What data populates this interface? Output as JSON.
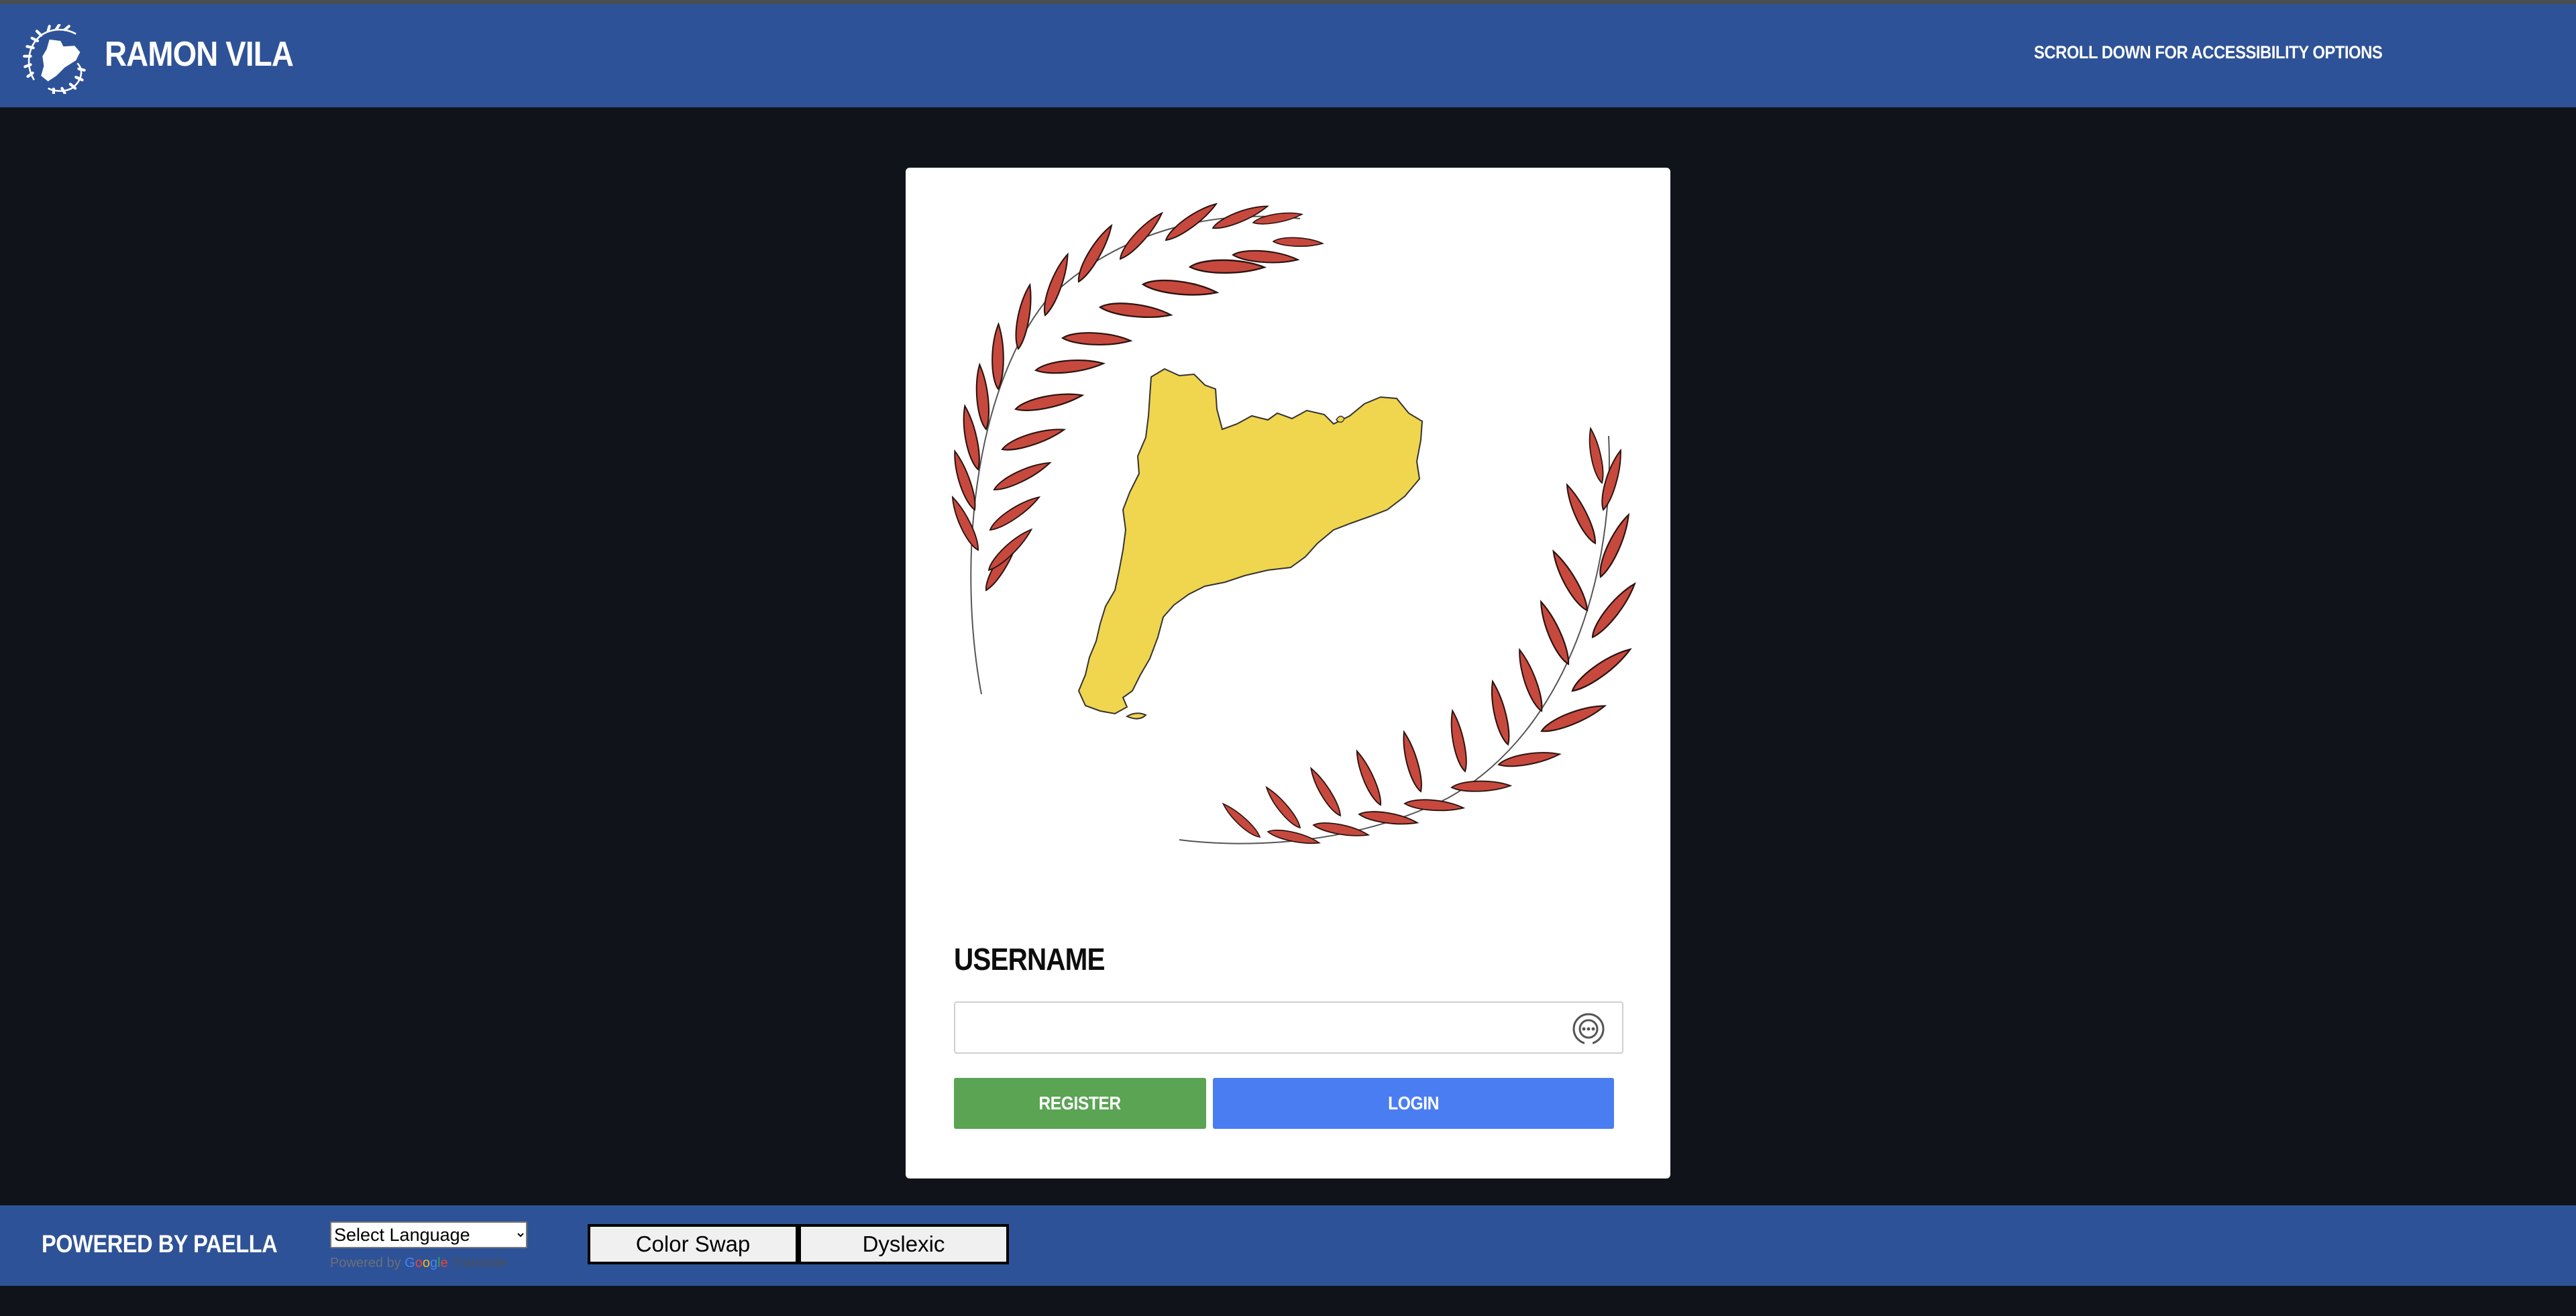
{
  "header": {
    "logo_icon": "catalonia-map-icon",
    "brand": "RAMON VILA",
    "accessibility_link": "SCROLL DOWN FOR ACCESSIBILITY OPTIONS"
  },
  "login": {
    "hero_image": "catalonia-map-with-laurel-illustration",
    "username_label": "USERNAME",
    "username_value": "",
    "password_manager_icon": "password-manager-icon",
    "register_label": "REGISTER",
    "login_label": "LOGIN"
  },
  "footer": {
    "powered_by": "POWERED BY PAELLA",
    "language_select": {
      "selected": "Select Language"
    },
    "translate_credit": {
      "prefix": "Powered by",
      "brand": "Google",
      "product": "Translate"
    },
    "color_swap_label": "Color Swap",
    "dyslexic_label": "Dyslexic"
  },
  "colors": {
    "header_bg": "#2e5297",
    "page_bg": "#10131a",
    "register_green": "#5aa454",
    "login_blue": "#4b7df2",
    "map_yellow": "#f0d54e",
    "leaf_red": "#c7493e"
  }
}
